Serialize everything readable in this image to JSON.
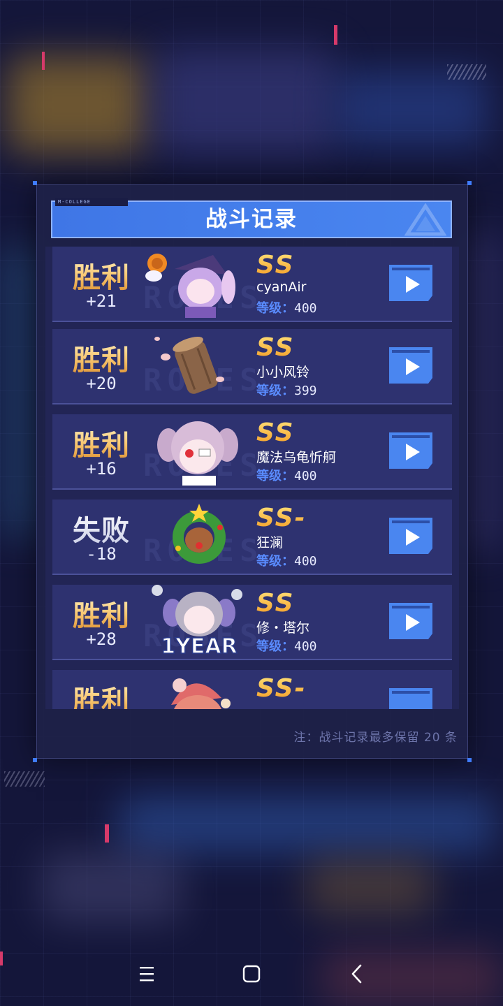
{
  "panel": {
    "tag": "M-COLLEGE",
    "title": "战斗记录",
    "note": "注：战斗记录最多保留 20 条"
  },
  "records": [
    {
      "result": "胜利",
      "outcome": "win",
      "score": "+21",
      "rank": "SS",
      "player": "cyanAir",
      "level_label": "等级：",
      "level": "400",
      "watermark": "ROSES",
      "avatar": "witch-girl-avatar"
    },
    {
      "result": "胜利",
      "outcome": "win",
      "score": "+20",
      "rank": "SS",
      "player": "小小风铃",
      "level_label": "等级：",
      "level": "399",
      "watermark": "ROSES",
      "avatar": "wood-log-avatar"
    },
    {
      "result": "胜利",
      "outcome": "win",
      "score": "+16",
      "rank": "SS",
      "player": "魔法乌龟忻舸",
      "level_label": "等级：",
      "level": "400",
      "watermark": "ROSES",
      "avatar": "pink-twintail-girl-avatar"
    },
    {
      "result": "失败",
      "outcome": "lose",
      "score": "-18",
      "rank": "SS-",
      "player": "狂澜",
      "level_label": "等级：",
      "level": "400",
      "watermark": "ROSES",
      "avatar": "reindeer-wreath-avatar"
    },
    {
      "result": "胜利",
      "outcome": "win",
      "score": "+28",
      "rank": "SS",
      "player": "修・塔尔",
      "level_label": "等级：",
      "level": "400",
      "watermark": "ROSES",
      "avatar": "1year-girl-avatar",
      "badge": "1YEAR"
    },
    {
      "result": "胜利",
      "outcome": "win",
      "score": "",
      "rank": "SS-",
      "player": "",
      "level_label": "",
      "level": "",
      "watermark": "",
      "avatar": "santa-hat-girl-avatar"
    }
  ],
  "colors": {
    "accent": "#4a86f0",
    "win": "#f7c46c",
    "rank": "#f39a22",
    "level_key": "#5a8cff"
  },
  "navbar": {
    "menu": "menu-icon",
    "home": "home-square-icon",
    "back": "back-chevron-icon"
  }
}
